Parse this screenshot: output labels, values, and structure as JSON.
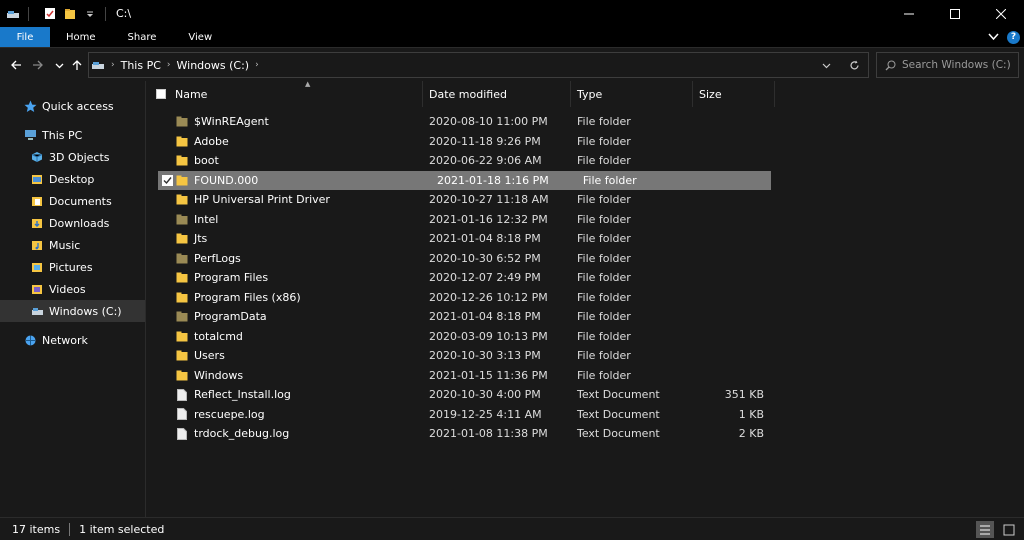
{
  "window": {
    "title": "C:\\"
  },
  "ribbon": {
    "tabs": [
      "File",
      "Home",
      "Share",
      "View"
    ]
  },
  "address": {
    "crumbs": [
      "This PC",
      "Windows (C:)"
    ]
  },
  "search": {
    "placeholder": "Search Windows (C:)"
  },
  "sidebar": {
    "items": [
      {
        "label": "Quick access",
        "icon": "star-icon"
      },
      {
        "label": "This PC",
        "icon": "computer-icon"
      },
      {
        "label": "3D Objects",
        "icon": "cube-icon"
      },
      {
        "label": "Desktop",
        "icon": "desktop-icon"
      },
      {
        "label": "Documents",
        "icon": "document-icon"
      },
      {
        "label": "Downloads",
        "icon": "download-icon"
      },
      {
        "label": "Music",
        "icon": "music-icon"
      },
      {
        "label": "Pictures",
        "icon": "picture-icon"
      },
      {
        "label": "Videos",
        "icon": "video-icon"
      },
      {
        "label": "Windows (C:)",
        "icon": "drive-icon"
      },
      {
        "label": "Network",
        "icon": "network-icon"
      }
    ]
  },
  "columns": {
    "name": "Name",
    "date": "Date modified",
    "type": "Type",
    "size": "Size"
  },
  "files": [
    {
      "name": "$WinREAgent",
      "date": "2020-08-10 11:00 PM",
      "type": "File folder",
      "size": "",
      "kind": "folder-dim"
    },
    {
      "name": "Adobe",
      "date": "2020-11-18 9:26 PM",
      "type": "File folder",
      "size": "",
      "kind": "folder"
    },
    {
      "name": "boot",
      "date": "2020-06-22 9:06 AM",
      "type": "File folder",
      "size": "",
      "kind": "folder"
    },
    {
      "name": "FOUND.000",
      "date": "2021-01-18 1:16 PM",
      "type": "File folder",
      "size": "",
      "kind": "folder",
      "selected": true
    },
    {
      "name": "HP Universal Print Driver",
      "date": "2020-10-27 11:18 AM",
      "type": "File folder",
      "size": "",
      "kind": "folder"
    },
    {
      "name": "Intel",
      "date": "2021-01-16 12:32 PM",
      "type": "File folder",
      "size": "",
      "kind": "folder-dim"
    },
    {
      "name": "Jts",
      "date": "2021-01-04 8:18 PM",
      "type": "File folder",
      "size": "",
      "kind": "folder"
    },
    {
      "name": "PerfLogs",
      "date": "2020-10-30 6:52 PM",
      "type": "File folder",
      "size": "",
      "kind": "folder-dim"
    },
    {
      "name": "Program Files",
      "date": "2020-12-07 2:49 PM",
      "type": "File folder",
      "size": "",
      "kind": "folder"
    },
    {
      "name": "Program Files (x86)",
      "date": "2020-12-26 10:12 PM",
      "type": "File folder",
      "size": "",
      "kind": "folder"
    },
    {
      "name": "ProgramData",
      "date": "2021-01-04 8:18 PM",
      "type": "File folder",
      "size": "",
      "kind": "folder-dim"
    },
    {
      "name": "totalcmd",
      "date": "2020-03-09 10:13 PM",
      "type": "File folder",
      "size": "",
      "kind": "folder"
    },
    {
      "name": "Users",
      "date": "2020-10-30 3:13 PM",
      "type": "File folder",
      "size": "",
      "kind": "folder"
    },
    {
      "name": "Windows",
      "date": "2021-01-15 11:36 PM",
      "type": "File folder",
      "size": "",
      "kind": "folder"
    },
    {
      "name": "Reflect_Install.log",
      "date": "2020-10-30 4:00 PM",
      "type": "Text Document",
      "size": "351 KB",
      "kind": "text"
    },
    {
      "name": "rescuepe.log",
      "date": "2019-12-25 4:11 AM",
      "type": "Text Document",
      "size": "1 KB",
      "kind": "text"
    },
    {
      "name": "trdock_debug.log",
      "date": "2021-01-08 11:38 PM",
      "type": "Text Document",
      "size": "2 KB",
      "kind": "text"
    }
  ],
  "status": {
    "count": "17 items",
    "selected": "1 item selected"
  },
  "colors": {
    "accent": "#1979ca",
    "folder": "#f5c542",
    "folder_dim": "#9a8a55",
    "selection": "#777777"
  }
}
